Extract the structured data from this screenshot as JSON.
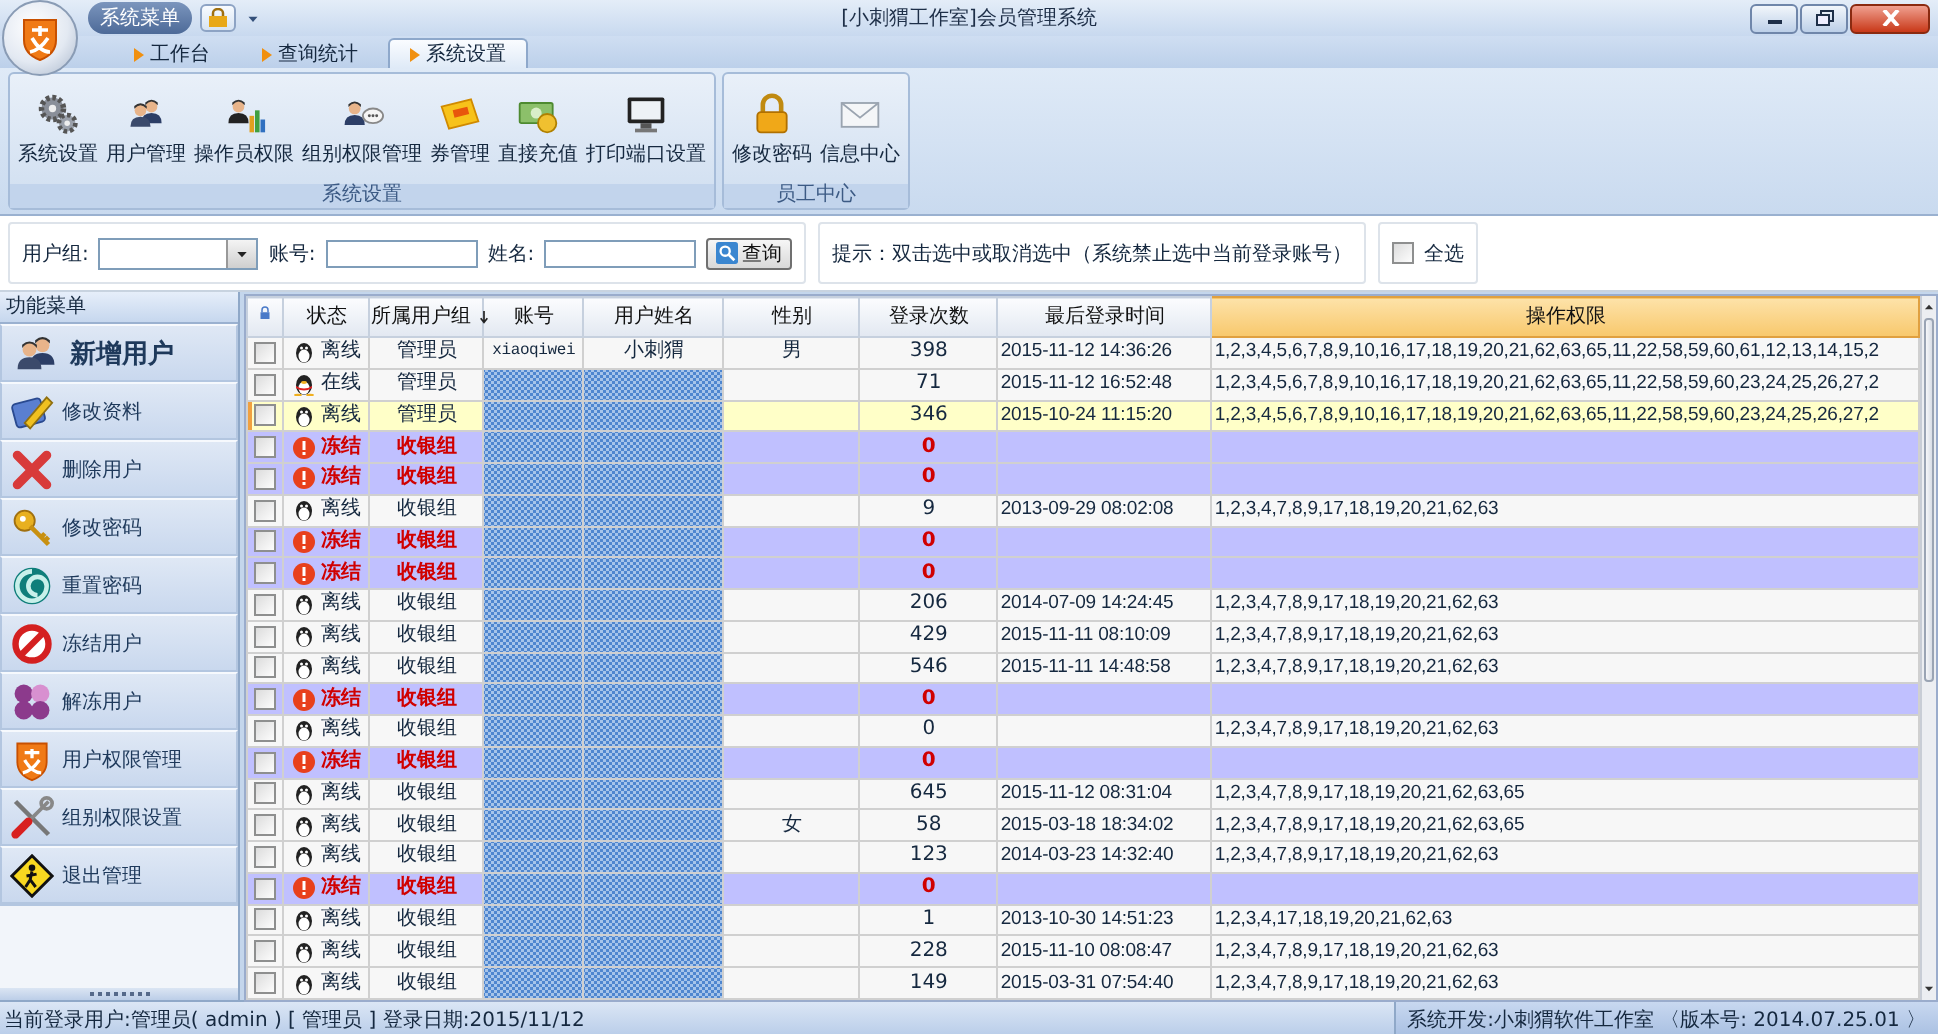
{
  "window": {
    "title": "[小刺猬工作室]会员管理系统",
    "menu_label": "系统菜单"
  },
  "tabs": [
    {
      "label": "工作台",
      "selected": false
    },
    {
      "label": "查询统计",
      "selected": false
    },
    {
      "label": "系统设置",
      "selected": true
    }
  ],
  "ribbon_groups": [
    {
      "title": "系统设置",
      "buttons": [
        "系统设置",
        "用户管理",
        "操作员权限",
        "组别权限管理",
        "券管理",
        "直接充值",
        "打印端口设置"
      ]
    },
    {
      "title": "员工中心",
      "buttons": [
        "修改密码",
        "信息中心"
      ]
    }
  ],
  "filter": {
    "group_label": "用户组:",
    "account_label": "账号:",
    "name_label": "姓名:",
    "search_button": "查询",
    "hint": "提示：双击选中或取消选中（系统禁止选中当前登录账号）",
    "select_all": {
      "label": "全选",
      "checked": false
    }
  },
  "sidebar": {
    "title": "功能菜单",
    "items": [
      {
        "label": "新增用户",
        "selected": true
      },
      {
        "label": "修改资料",
        "selected": false
      },
      {
        "label": "删除用户",
        "selected": false
      },
      {
        "label": "修改密码",
        "selected": false
      },
      {
        "label": "重置密码",
        "selected": false
      },
      {
        "label": "冻结用户",
        "selected": false
      },
      {
        "label": "解冻用户",
        "selected": false
      },
      {
        "label": "用户权限管理",
        "selected": false
      },
      {
        "label": "组别权限设置",
        "selected": false
      },
      {
        "label": "退出管理",
        "selected": false
      }
    ]
  },
  "table": {
    "columns": [
      {
        "label": "状态",
        "sorted": false,
        "selected": false
      },
      {
        "label": "所属用户组",
        "sorted": true,
        "selected": false
      },
      {
        "label": "账号",
        "sorted": false,
        "selected": false
      },
      {
        "label": "用户姓名",
        "sorted": false,
        "selected": false
      },
      {
        "label": "性别",
        "sorted": false,
        "selected": false
      },
      {
        "label": "登录次数",
        "sorted": false,
        "selected": false
      },
      {
        "label": "最后登录时间",
        "sorted": false,
        "selected": false
      },
      {
        "label": "操作权限",
        "sorted": false,
        "selected": true
      }
    ],
    "rows": [
      {
        "kind": "offline",
        "status": "离线",
        "group": "管理员",
        "account": "xiaoqiwei",
        "name": "小刺猬",
        "gender": "男",
        "logins": "398",
        "last_login": "2015-11-12 14:36:26",
        "permissions": "1,2,3,4,5,6,7,8,9,10,16,17,18,19,20,21,62,63,65,11,22,58,59,60,61,12,13,14,15,2",
        "checked": false,
        "selected": false
      },
      {
        "kind": "online",
        "status": "在线",
        "group": "管理员",
        "logins": "71",
        "last_login": "2015-11-12 16:52:48",
        "permissions": "1,2,3,4,5,6,7,8,9,10,16,17,18,19,20,21,62,63,65,11,22,58,59,60,23,24,25,26,27,2",
        "checked": false,
        "selected": false
      },
      {
        "kind": "offline",
        "status": "离线",
        "group": "管理员",
        "logins": "346",
        "last_login": "2015-10-24 11:15:20",
        "permissions": "1,2,3,4,5,6,7,8,9,10,16,17,18,19,20,21,62,63,65,11,22,58,59,60,23,24,25,26,27,2",
        "checked": false,
        "selected": true
      },
      {
        "kind": "frozen",
        "status": "冻结",
        "group": "收银组",
        "logins": "0",
        "checked": false,
        "selected": false
      },
      {
        "kind": "frozen",
        "status": "冻结",
        "group": "收银组",
        "logins": "0",
        "checked": false,
        "selected": false
      },
      {
        "kind": "offline",
        "status": "离线",
        "group": "收银组",
        "logins": "9",
        "last_login": "2013-09-29 08:02:08",
        "permissions": "1,2,3,4,7,8,9,17,18,19,20,21,62,63",
        "checked": false,
        "selected": false
      },
      {
        "kind": "frozen",
        "status": "冻结",
        "group": "收银组",
        "logins": "0",
        "checked": false,
        "selected": false
      },
      {
        "kind": "frozen",
        "status": "冻结",
        "group": "收银组",
        "logins": "0",
        "checked": false,
        "selected": false
      },
      {
        "kind": "offline",
        "status": "离线",
        "group": "收银组",
        "logins": "206",
        "last_login": "2014-07-09 14:24:45",
        "permissions": "1,2,3,4,7,8,9,17,18,19,20,21,62,63",
        "checked": false,
        "selected": false
      },
      {
        "kind": "offline",
        "status": "离线",
        "group": "收银组",
        "logins": "429",
        "last_login": "2015-11-11 08:10:09",
        "permissions": "1,2,3,4,7,8,9,17,18,19,20,21,62,63",
        "checked": false,
        "selected": false
      },
      {
        "kind": "offline",
        "status": "离线",
        "group": "收银组",
        "logins": "546",
        "last_login": "2015-11-11 14:48:58",
        "permissions": "1,2,3,4,7,8,9,17,18,19,20,21,62,63",
        "checked": false,
        "selected": false
      },
      {
        "kind": "frozen",
        "status": "冻结",
        "group": "收银组",
        "logins": "0",
        "checked": false,
        "selected": false
      },
      {
        "kind": "offline",
        "status": "离线",
        "group": "收银组",
        "logins": "0",
        "permissions": "1,2,3,4,7,8,9,17,18,19,20,21,62,63",
        "checked": false,
        "selected": false
      },
      {
        "kind": "frozen",
        "status": "冻结",
        "group": "收银组",
        "logins": "0",
        "checked": false,
        "selected": false
      },
      {
        "kind": "offline",
        "status": "离线",
        "group": "收银组",
        "logins": "645",
        "last_login": "2015-11-12 08:31:04",
        "permissions": "1,2,3,4,7,8,9,17,18,19,20,21,62,63,65",
        "checked": false,
        "selected": false
      },
      {
        "kind": "offline",
        "status": "离线",
        "group": "收银组",
        "gender": "女",
        "logins": "58",
        "last_login": "2015-03-18 18:34:02",
        "permissions": "1,2,3,4,7,8,9,17,18,19,20,21,62,63,65",
        "checked": false,
        "selected": false
      },
      {
        "kind": "offline",
        "status": "离线",
        "group": "收银组",
        "logins": "123",
        "last_login": "2014-03-23 14:32:40",
        "permissions": "1,2,3,4,7,8,9,17,18,19,20,21,62,63",
        "checked": false,
        "selected": false
      },
      {
        "kind": "frozen",
        "status": "冻结",
        "group": "收银组",
        "logins": "0",
        "checked": false,
        "selected": false
      },
      {
        "kind": "offline",
        "status": "离线",
        "group": "收银组",
        "logins": "1",
        "last_login": "2013-10-30 14:51:23",
        "permissions": "1,2,3,4,17,18,19,20,21,62,63",
        "checked": false,
        "selected": false
      },
      {
        "kind": "offline",
        "status": "离线",
        "group": "收银组",
        "logins": "228",
        "last_login": "2015-11-10 08:08:47",
        "permissions": "1,2,3,4,7,8,9,17,18,19,20,21,62,63",
        "checked": false,
        "selected": false
      },
      {
        "kind": "offline",
        "status": "离线",
        "group": "收银组",
        "logins": "149",
        "last_login": "2015-03-31 07:54:40",
        "permissions": "1,2,3,4,7,8,9,17,18,19,20,21,62,63",
        "checked": false,
        "selected": false
      }
    ]
  },
  "status_bar": {
    "left": "当前登录用户:管理员( admin ) [ 管理员 ] 登录日期:2015/11/12",
    "right": "系统开发:小刺猬软件工作室 〈版本号: 2014.07.25.01 〉"
  }
}
